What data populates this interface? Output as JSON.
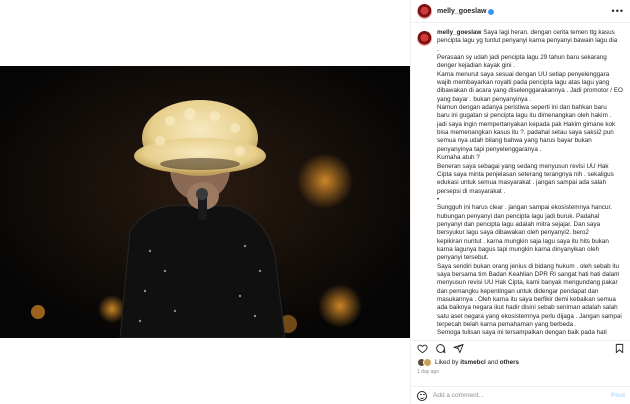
{
  "post": {
    "username": "melly_goeslaw",
    "more_icon": "more-horizontal-icon"
  },
  "photo": {
    "alt": "Singer in fluffy hat holding microphone on stage"
  },
  "caption": {
    "username": "melly_goeslaw",
    "lines": [
      "Saya lagi heran. dengan cerita temen ttg kasus",
      "pencipta lagu yg tuntut penyanyi karna penyanyi bawain lagu dia",
      ".",
      "Perasaan sy udah jadi pencipta lagu 29 tahun baru sekarang",
      "denger kejadian kayak gini .",
      "Karna menurut saya sesuai dengan UU setiap penyelenggara",
      "wajib membayarkan royalti pada pencipta lagu atas lagu yang",
      "dibawakan di acara yang diselenggarakannya . Jadi promotor / EO",
      "yang bayar . bukan penyanyinya .",
      "Namun dengan adanya peristiwa seperti ini dan bahkan baru",
      "baru ini gugatan si pencipta lagu itu dimenangkan oleh hakim .",
      "jadi saya ingin mempertanyakan kepada pak Hakim gimane kok",
      "bisa memenangkan kasus itu ?. padahal setau saya saksi2 pun",
      "semua nya udah bilang bahwa yang harus bayar bukan",
      "penyanyinya tapi penyelenggaranya .",
      "Kumaha atuh ?",
      "Beneran saya sebagai yang sedang menyusun revisi UU Hak",
      "Cipta saya minta penjelasan seterang terangnya nih . sekaligus",
      "edukasi untuk semua masyarakat . jangan sampai ada salah",
      "persepsi di masyarakat .",
      "•",
      "Sungguh ini harus clear . jangan sampai ekosistemnya hancur.",
      "hubungan penyanyi dan pencipta lagu jadi buruk. Padahal",
      "penyanyi dan pencipta lagu adalah mitra sejajar. Dan saya",
      "bersyukur lagu saya dibawakan oleh penyanyi2. bero2",
      "kepikiran nuntut . karna mungkin saja lagu saya itu hits bukan",
      "karna lagunya bagus tapi mungkin karna dinyanyikan oleh",
      "penyanyi tersebut.",
      "Saya sendiri bukan orang jenius di bidang hukum . oleh sebab itu",
      "saya bersama tim Badan Keahlian DPR RI sangat hati hati dalam",
      "menyusun revisi UU Hak Cipta, kami banyak mengundang pakar",
      "dan pemangku kepentingan untuk didengar pendapat dan",
      "masukannya . Oleh karna itu saya berfikir demi kebaikan semua",
      "ada baiknya negara ikut hadir disini sebab seniman adalah salah",
      "satu aset negara yang ekosistemnya perlu dijaga . Jangan sampai",
      "terpecah belah karna pemahaman yang berbeda .",
      "Semoga tulisan saya ini tersampaikan dengan baik pada hati"
    ]
  },
  "actions": {
    "like_icon": "heart-icon",
    "comment_icon": "comment-icon",
    "share_icon": "send-icon",
    "save_icon": "bookmark-icon"
  },
  "likes": {
    "prefix": "Liked by ",
    "user": "itsmebcl",
    "middle": " and ",
    "others": "others"
  },
  "time": "1 day ago",
  "comment": {
    "placeholder": "Add a comment...",
    "post_label": "Post"
  }
}
